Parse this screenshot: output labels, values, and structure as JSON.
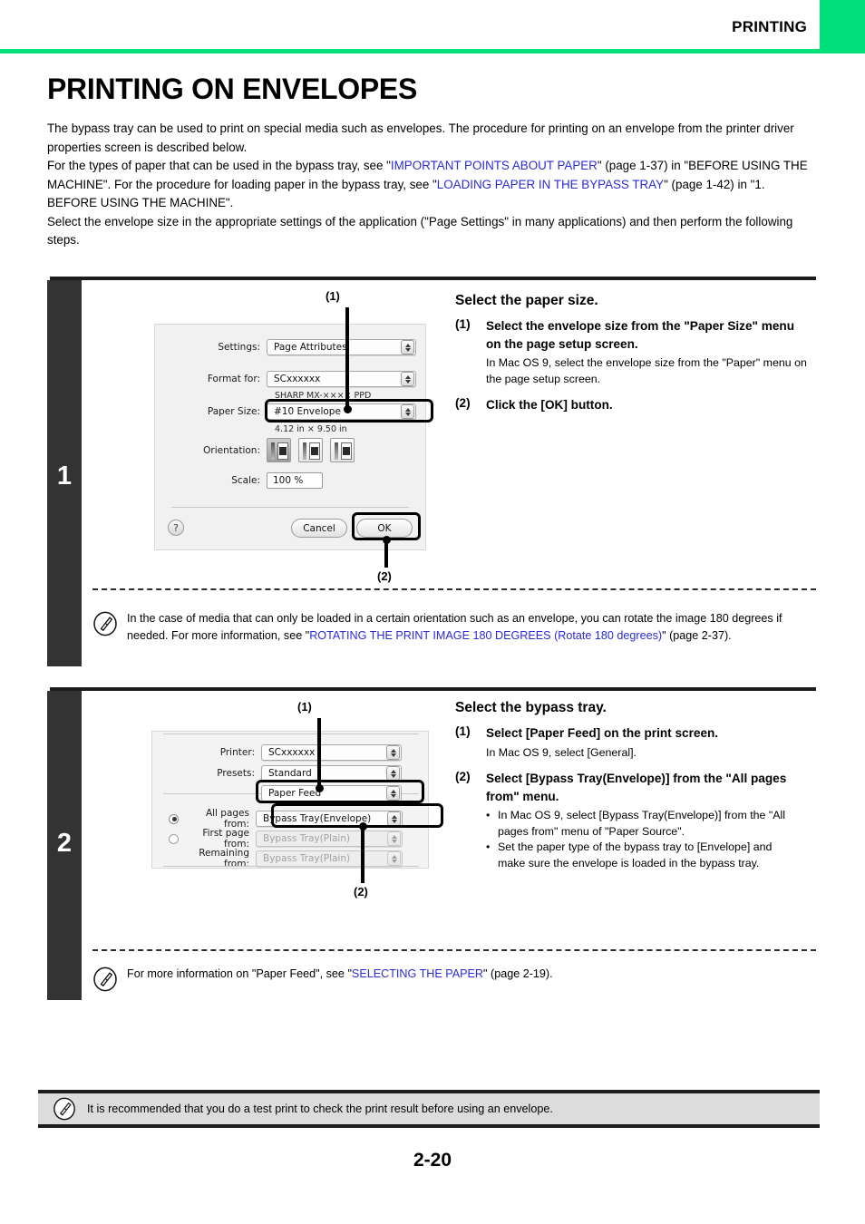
{
  "header": {
    "title": "PRINTING",
    "accent_color": "#00e07a"
  },
  "page": {
    "title": "PRINTING ON ENVELOPES",
    "number": "2-20"
  },
  "intro": {
    "p1": "The bypass tray can be used to print on special media such as envelopes. The procedure for printing on an envelope from the printer driver properties screen is described below.",
    "p2_a": "For the types of paper that can be used in the bypass tray, see \"",
    "p2_link1": "IMPORTANT POINTS ABOUT PAPER",
    "p2_b": "\" (page 1-37) in \"BEFORE USING THE MACHINE\". For the procedure for loading paper in the bypass tray, see \"",
    "p2_link2": "LOADING PAPER IN THE BYPASS TRAY",
    "p2_c": "\" (page 1-42) in \"1. BEFORE USING THE MACHINE\".",
    "p3": "Select the envelope size in the appropriate settings of the application (\"Page Settings\" in many applications) and then perform the following steps."
  },
  "step1": {
    "number": "1",
    "heading": "Select the paper size.",
    "items": [
      {
        "marker": "(1)",
        "main": "Select the envelope size from the \"Paper Size\" menu on the page setup screen.",
        "sub": "In Mac OS 9, select the envelope size from the \"Paper\" menu on the page setup screen."
      },
      {
        "marker": "(2)",
        "main": "Click the [OK] button."
      }
    ],
    "callout_1": "(1)",
    "callout_2": "(2)",
    "dialog": {
      "settings_label": "Settings:",
      "settings_value": "Page Attributes",
      "format_label": "Format for:",
      "format_value": "SCxxxxxx",
      "ppd_text": "SHARP MX-×××× PPD",
      "paper_size_label": "Paper Size:",
      "paper_size_value": "#10 Envelope",
      "paper_dims": "4.12 in × 9.50 in",
      "orientation_label": "Orientation:",
      "scale_label": "Scale:",
      "scale_value": "100 %",
      "help_glyph": "?",
      "cancel_label": "Cancel",
      "ok_label": "OK"
    },
    "note": {
      "a": "In the case of media that can only be loaded in a certain orientation such as an envelope, you can rotate the image 180 degrees if needed. For more information, see \"",
      "link": "ROTATING THE PRINT IMAGE 180 DEGREES (Rotate 180 degrees)",
      "b": "\" (page 2-37)."
    }
  },
  "step2": {
    "number": "2",
    "heading": "Select the bypass tray.",
    "items": [
      {
        "marker": "(1)",
        "main": "Select [Paper Feed] on the print screen.",
        "sub": "In Mac OS 9, select [General]."
      },
      {
        "marker": "(2)",
        "main": "Select [Bypass Tray(Envelope)] from the \"All pages from\" menu.",
        "bullets": [
          "In Mac OS 9, select [Bypass Tray(Envelope)] from the \"All pages from\" menu of \"Paper Source\".",
          "Set the paper type of the bypass tray to [Envelope] and make sure the envelope is loaded in the bypass tray."
        ]
      }
    ],
    "callout_1": "(1)",
    "callout_2": "(2)",
    "dialog": {
      "printer_label": "Printer:",
      "printer_value": "SCxxxxxx",
      "presets_label": "Presets:",
      "presets_value": "Standard",
      "pane_value": "Paper Feed",
      "all_pages_label": "All pages from:",
      "all_pages_value": "Bypass Tray(Envelope)",
      "first_page_label": "First page from:",
      "first_page_value": "Bypass Tray(Plain)",
      "remaining_label": "Remaining from:",
      "remaining_value": "Bypass Tray(Plain)"
    },
    "note": {
      "a": "For more information on \"Paper Feed\", see \"",
      "link": "SELECTING THE PAPER",
      "b": "\" (page 2-19)."
    }
  },
  "recommendation": {
    "text": "It is recommended that you do a test print to check the print result before using an envelope."
  }
}
